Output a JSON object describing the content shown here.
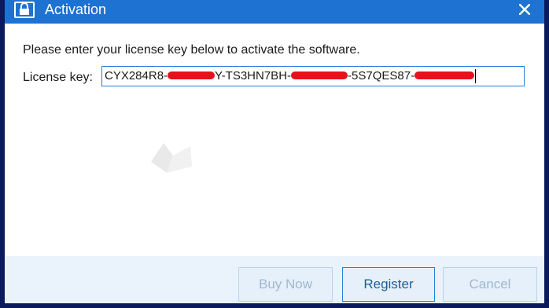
{
  "window": {
    "title": "Activation",
    "close_glyph": "✕"
  },
  "prompt": "Please enter your license key below to activate the software.",
  "license": {
    "label": "License key:",
    "segments": [
      "CYX284R8-",
      "Y-TS3HN7BH-",
      "-5S7QES87-"
    ]
  },
  "buttons": {
    "buy_now": "Buy Now",
    "register": "Register",
    "cancel": "Cancel"
  },
  "colors": {
    "titlebar": "#1e73d2",
    "accent": "#2a7fd4",
    "redaction": "#e4131b"
  },
  "icons": {
    "title": "lock-icon",
    "close": "close-icon",
    "watermark": "watermark-logo"
  }
}
